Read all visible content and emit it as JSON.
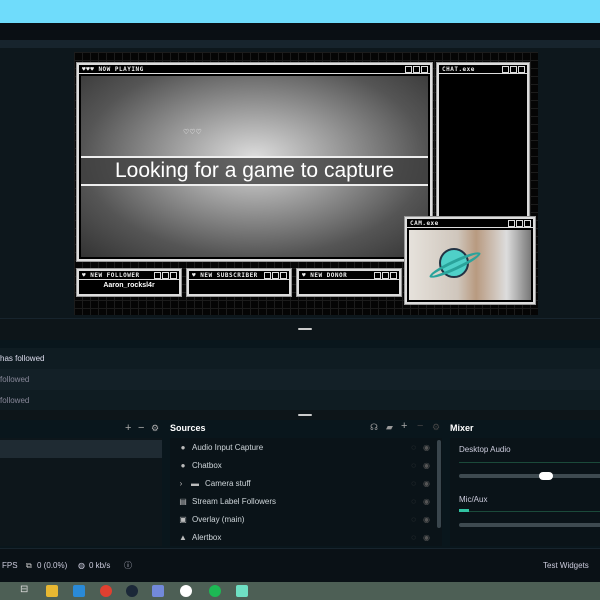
{
  "preview": {
    "now_playing_title": "♥♥♥ NOW PLAYING",
    "capture_message": "Looking for a game to capture",
    "chat_title": "CHAT.exe",
    "cam_title": "CAM.exe",
    "hearts": "♡♡♡",
    "alerts": [
      {
        "title": "♥ NEW FOLLOWER",
        "value": "Aaron_rocksl4r"
      },
      {
        "title": "♥ NEW SUBSCRIBER",
        "value": ""
      },
      {
        "title": "♥ NEW DONOR",
        "value": ""
      }
    ]
  },
  "events": [
    "has followed",
    "followed",
    "followed"
  ],
  "scenes": {
    "add": "+",
    "remove": "−",
    "settings": "⚙"
  },
  "sources": {
    "title": "Sources",
    "items": [
      {
        "icon": "microphone-icon",
        "glyph": "🎙",
        "label": "Audio Input Capture"
      },
      {
        "icon": "chat-icon",
        "glyph": "💬",
        "label": "Chatbox"
      },
      {
        "icon": "folder-icon",
        "glyph": "▬",
        "label": "Camera stuff",
        "folder": true
      },
      {
        "icon": "file-icon",
        "glyph": "▤",
        "label": "Stream Label Followers"
      },
      {
        "icon": "image-icon",
        "glyph": "▣",
        "label": "Overlay (main)"
      },
      {
        "icon": "bell-icon",
        "glyph": "▲",
        "label": "Alertbox"
      }
    ]
  },
  "mixer": {
    "title": "Mixer",
    "channels": [
      {
        "name": "Desktop Audio",
        "volume": 0.55
      },
      {
        "name": "Mic/Aux",
        "volume": 1.0
      }
    ]
  },
  "status": {
    "fps": "FPS",
    "dropped": "0 (0.0%)",
    "bitrate": "0 kb/s",
    "test_widgets": "Test Widgets"
  },
  "colors": {
    "taskbar": "#4d5f55",
    "accent": "#31c3a2",
    "desktop": "#6fdcfb"
  }
}
